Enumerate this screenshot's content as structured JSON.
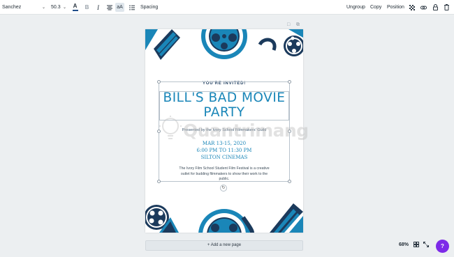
{
  "toolbar": {
    "font_family": "Sanchez",
    "font_size": "50.3",
    "text_color_icon": "A",
    "bold_icon": "B",
    "italic_icon": "I",
    "case_icon": "aA",
    "spacing_label": "Spacing",
    "ungroup_label": "Ungroup",
    "copy_label": "Copy",
    "position_label": "Position",
    "text_color_hex": "#1f4e8a"
  },
  "page": {
    "invited": "YOU'RE INVITED!",
    "title_line1": "BILL'S BAD MOVIE",
    "title_line2": "PARTY",
    "presented_by": "Presented by the Ivory School Filmmakers' Guild",
    "date": "MAR 13-15, 2020",
    "time": "6:00 PM TO 11:30 PM",
    "venue": "SILTON CINEMAS",
    "description": "The Ivory Film School Student Film Festival is a creative outlet for budding filmmakers to show their work to the public.",
    "accent_color": "#1a86b8",
    "navy_color": "#1b3a5c"
  },
  "watermark": "Quantrimang",
  "add_page_label": "+ Add a new page",
  "zoom_level": "68%",
  "help_label": "?"
}
